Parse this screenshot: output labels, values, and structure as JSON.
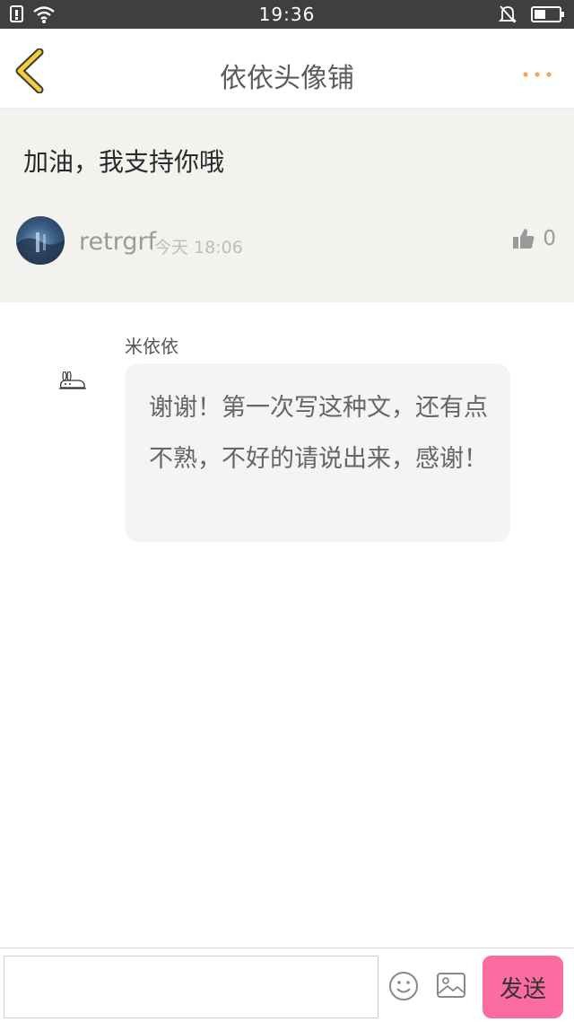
{
  "status_bar": {
    "time": "19:36"
  },
  "header": {
    "title": "依依头像铺",
    "back_icon": "chevron-left-icon",
    "more_icon": "more-dots-icon"
  },
  "comment": {
    "text": "加油，我支持你哦",
    "username": "retrgrf",
    "time": "今天 18:06",
    "like_count": "0"
  },
  "reply": {
    "author": "米依依",
    "text": "谢谢！第一次写这种文，还有点不熟，不好的请说出来，感谢！"
  },
  "input_bar": {
    "placeholder": "",
    "send_label": "发送"
  },
  "colors": {
    "status_bar": "#3f3f3f",
    "comment_bg": "#f2f3ee",
    "back_icon": "#f3cd3a",
    "more_dots": "#f6a35f",
    "send_button": "#fb6da1"
  }
}
